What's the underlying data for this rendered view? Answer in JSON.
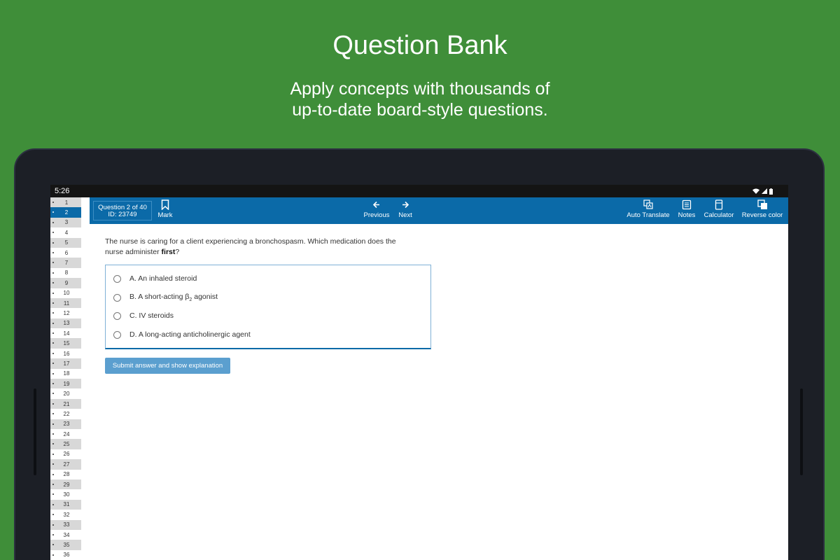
{
  "promo": {
    "title": "Question Bank",
    "subtitle_line1": "Apply concepts with thousands of",
    "subtitle_line2": "up-to-date board-style questions."
  },
  "status_bar": {
    "time": "5:26"
  },
  "question_nav": {
    "items": [
      "1",
      "2",
      "3",
      "4",
      "5",
      "6",
      "7",
      "8",
      "9",
      "10",
      "11",
      "12",
      "13",
      "14",
      "15",
      "16",
      "17",
      "18",
      "19",
      "20",
      "21",
      "22",
      "23",
      "24",
      "25",
      "26",
      "27",
      "28",
      "29",
      "30",
      "31",
      "32",
      "33",
      "34",
      "35",
      "36"
    ],
    "active_index": 1
  },
  "toolbar": {
    "question_label": "Question 2 of 40",
    "id_label": "ID: 23749",
    "mark_label": "Mark",
    "previous_label": "Previous",
    "next_label": "Next",
    "auto_translate_label": "Auto Translate",
    "notes_label": "Notes",
    "calculator_label": "Calculator",
    "reverse_color_label": "Reverse color"
  },
  "question": {
    "stem_part1": "The nurse is caring for a client experiencing a bronchospasm. Which medication does the",
    "stem_part2": "nurse administer ",
    "stem_bold": "first",
    "stem_end": "?"
  },
  "answers": {
    "a": "A. An inhaled steroid",
    "b_prefix": "B. A short-acting β",
    "b_sub": "2",
    "b_suffix": " agonist",
    "c": "C. IV steroids",
    "d": "D.  A long-acting anticholinergic agent"
  },
  "submit_label": "Submit answer and show explanation",
  "colors": {
    "background": "#3f8e39",
    "toolbar": "#0b6aa8",
    "submit": "#5b9fcf",
    "list_stripe": "#d8d8d8"
  }
}
